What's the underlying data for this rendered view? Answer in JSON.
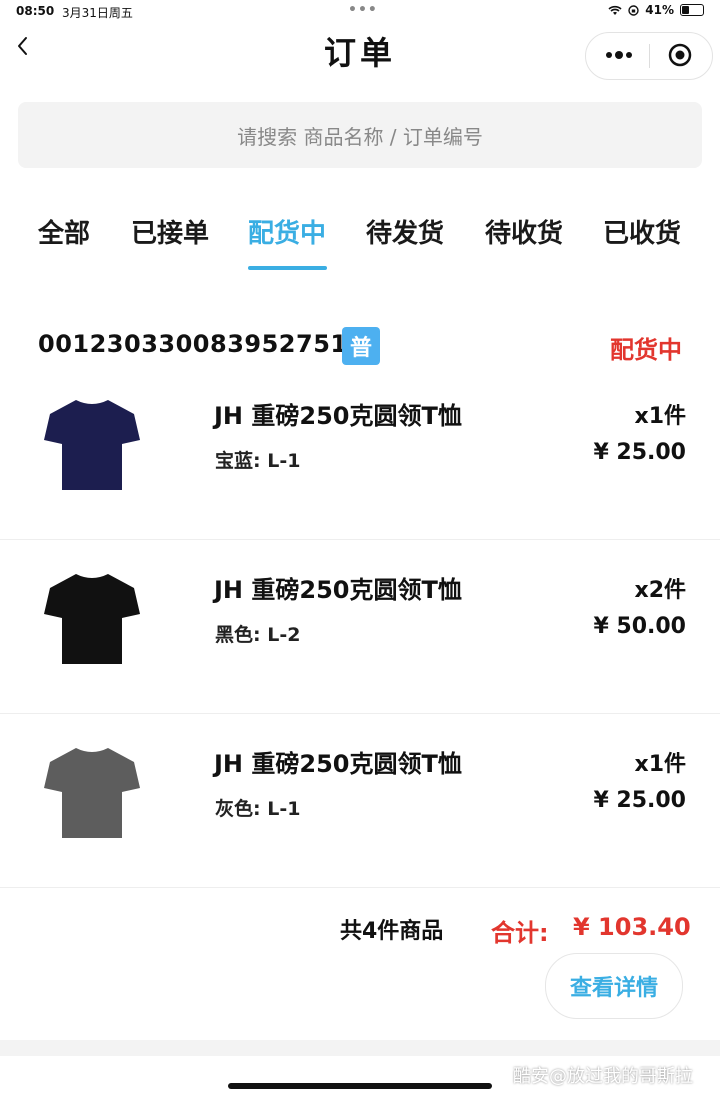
{
  "status_bar": {
    "time": "08:50",
    "date": "3月31日周五",
    "dots": "•••",
    "battery": "41%",
    "battery_level": 0.41
  },
  "nav": {
    "title": "订单",
    "more_icon": "more-dots-icon",
    "close_icon": "target-circle-icon",
    "back_icon": "chevron-left-icon"
  },
  "search": {
    "placeholder": "请搜索 商品名称 / 订单编号"
  },
  "tabs": [
    {
      "label": "全部",
      "active": false
    },
    {
      "label": "已接单",
      "active": false
    },
    {
      "label": "配货中",
      "active": true
    },
    {
      "label": "待发货",
      "active": false
    },
    {
      "label": "待收货",
      "active": false
    },
    {
      "label": "已收货",
      "active": false
    }
  ],
  "order": {
    "number": "0012303300839527518 7",
    "badge": "普",
    "status": "配货中",
    "items": [
      {
        "title": "JH 重磅250克圆领T恤",
        "spec": "宝蓝: L-1",
        "qty": "x1件",
        "price": "¥ 25.00",
        "color": "#1c1e4f"
      },
      {
        "title": "JH 重磅250克圆领T恤",
        "spec": "黑色: L-2",
        "qty": "x2件",
        "price": "¥ 50.00",
        "color": "#111111"
      },
      {
        "title": "JH 重磅250克圆领T恤",
        "spec": "灰色: L-1",
        "qty": "x1件",
        "price": "¥ 25.00",
        "color": "#5d5d5d"
      }
    ],
    "total_count": "共4件商品",
    "total_label": "合计:",
    "total_amount": "¥ 103.40",
    "detail_button": "查看详情"
  },
  "watermark": "酷安@放过我的哥斯拉",
  "colors": {
    "accent": "#3aaee3",
    "status_red": "#e2362e",
    "badge_blue": "#4db0f0"
  }
}
